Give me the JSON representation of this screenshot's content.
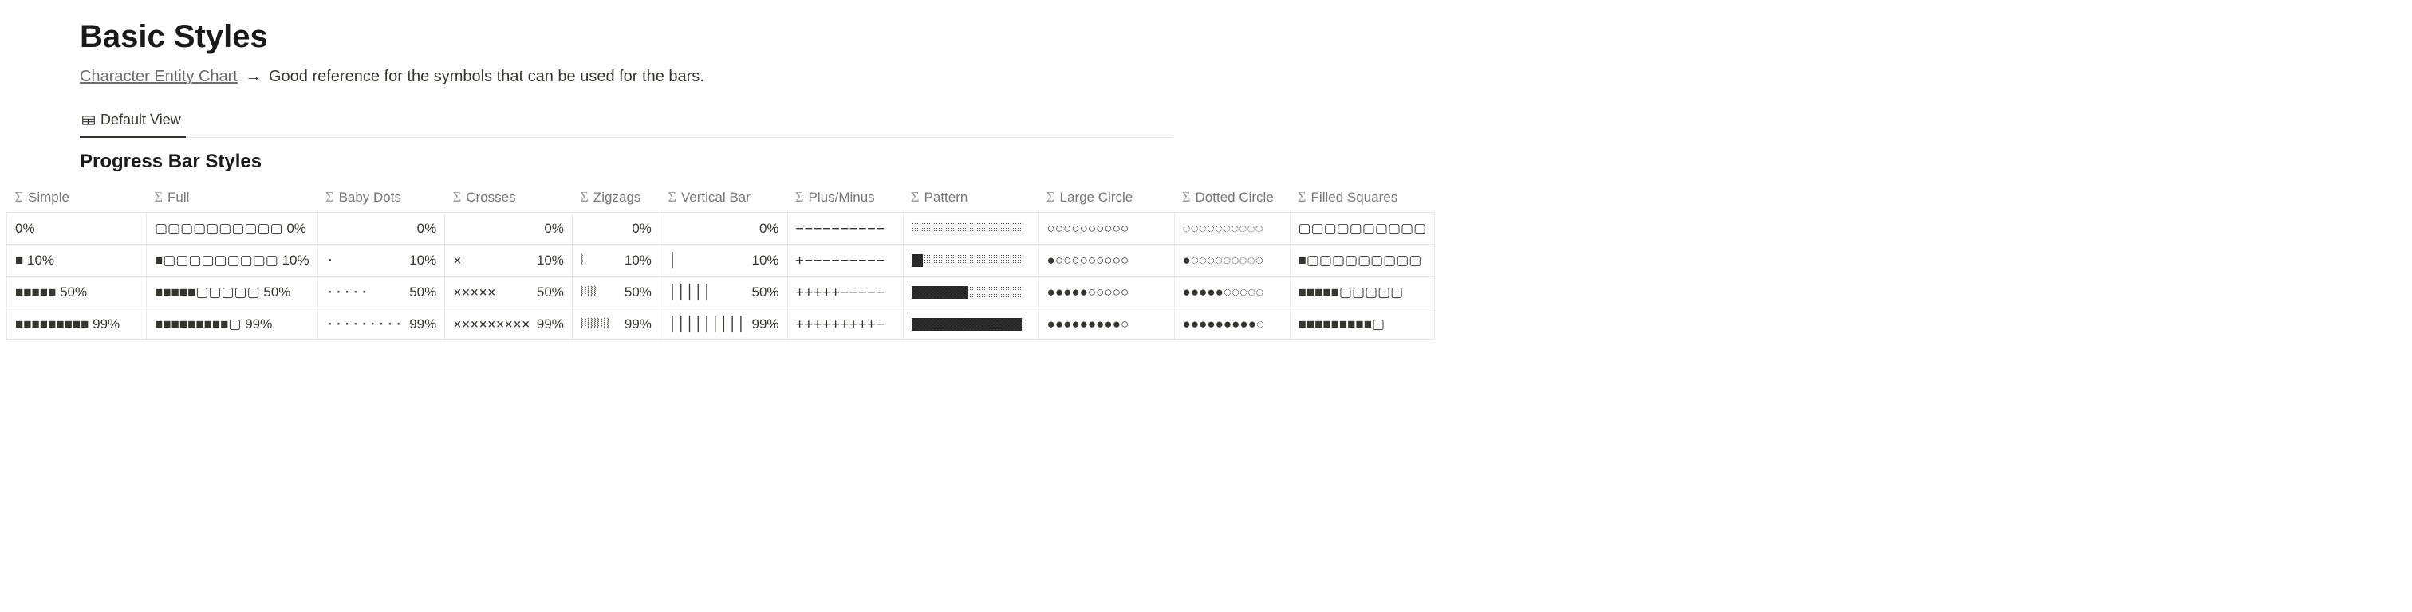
{
  "heading": "Basic Styles",
  "subtitle": {
    "link_text": "Character Entity Chart",
    "arrow": "→",
    "rest": "Good reference for the symbols that can be used for the bars."
  },
  "tab_label": "Default View",
  "table_title": "Progress Bar Styles",
  "columns": [
    "Simple",
    "Full",
    "Baby Dots",
    "Crosses",
    "Zigzags",
    "Vertical Bar",
    "Plus/Minus",
    "Pattern",
    "Large Circle",
    "Dotted Circle",
    "Filled Squares"
  ],
  "rows": [
    {
      "simple": "0%",
      "full": "▢▢▢▢▢▢▢▢▢▢ 0%",
      "baby_dots": {
        "bar": "",
        "pct": "0%"
      },
      "crosses": {
        "bar": "",
        "pct": "0%"
      },
      "zigzags": {
        "bar": "",
        "pct": "0%"
      },
      "vertical": {
        "bar": "",
        "pct": "0%"
      },
      "plusminus": "−−−−−−−−−−",
      "pattern_pct": 0,
      "large_circle": "○○○○○○○○○○",
      "dotted_circle": "◌◌◌◌◌◌◌◌◌◌",
      "filled_squares": "▢▢▢▢▢▢▢▢▢▢"
    },
    {
      "simple": "■ 10%",
      "full": "■▢▢▢▢▢▢▢▢▢ 10%",
      "baby_dots": {
        "bar": "·",
        "pct": "10%"
      },
      "crosses": {
        "bar": "×",
        "pct": "10%"
      },
      "zigzags": {
        "bar": "⦚",
        "pct": "10%"
      },
      "vertical": {
        "bar": "│",
        "pct": "10%"
      },
      "plusminus": "+−−−−−−−−−",
      "pattern_pct": 10,
      "large_circle": "●○○○○○○○○○",
      "dotted_circle": "●◌◌◌◌◌◌◌◌◌",
      "filled_squares": "■▢▢▢▢▢▢▢▢▢"
    },
    {
      "simple": "■■■■■ 50%",
      "full": "■■■■■▢▢▢▢▢ 50%",
      "baby_dots": {
        "bar": "·····",
        "pct": "50%"
      },
      "crosses": {
        "bar": "×××××",
        "pct": "50%"
      },
      "zigzags": {
        "bar": "⦚⦚⦚⦚⦚",
        "pct": "50%"
      },
      "vertical": {
        "bar": "│││││",
        "pct": "50%"
      },
      "plusminus": "+++++−−−−−",
      "pattern_pct": 50,
      "large_circle": "●●●●●○○○○○",
      "dotted_circle": "●●●●●◌◌◌◌◌",
      "filled_squares": "■■■■■▢▢▢▢▢"
    },
    {
      "simple": "■■■■■■■■■ 99%",
      "full": "■■■■■■■■■▢ 99%",
      "baby_dots": {
        "bar": "·········",
        "pct": "99%"
      },
      "crosses": {
        "bar": "×××××××××",
        "pct": "99%"
      },
      "zigzags": {
        "bar": "⦚⦚⦚⦚⦚⦚⦚⦚⦚",
        "pct": "99%"
      },
      "vertical": {
        "bar": "│││││││││",
        "pct": "99%"
      },
      "plusminus": "+++++++++−",
      "pattern_pct": 99,
      "large_circle": "●●●●●●●●●○",
      "dotted_circle": "●●●●●●●●●◌",
      "filled_squares": "■■■■■■■■■▢"
    }
  ]
}
